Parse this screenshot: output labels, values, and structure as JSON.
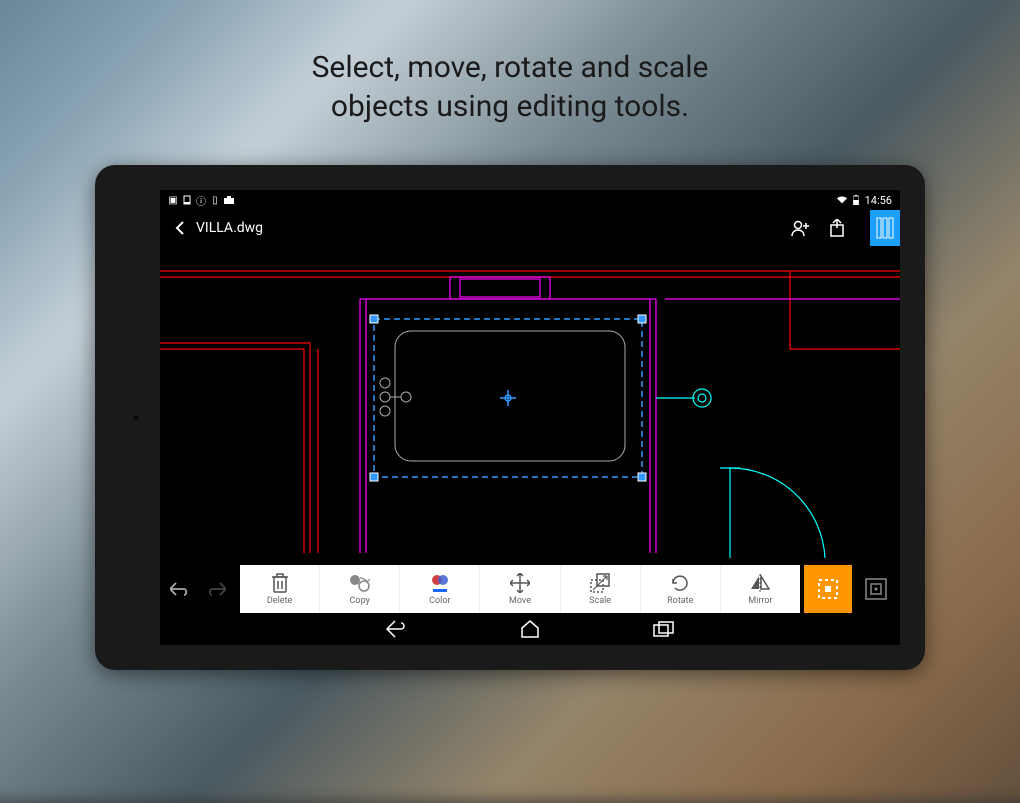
{
  "promo": {
    "line1": "Select, move, rotate and scale",
    "line2": "objects using editing tools."
  },
  "status": {
    "time": "14:56"
  },
  "header": {
    "filename": "VILLA.dwg"
  },
  "toolbar": {
    "delete": "Delete",
    "copy": "Copy",
    "color": "Color",
    "move": "Move",
    "scale": "Scale",
    "rotate": "Rotate",
    "mirror": "Mirror"
  },
  "colors": {
    "accent_blue": "#1a9fff",
    "accent_orange": "#ff9800",
    "wall_red": "#ff0000",
    "door_magenta": "#ff00ff",
    "fixture_cyan": "#00ffff",
    "selection_blue": "#3399ff"
  }
}
